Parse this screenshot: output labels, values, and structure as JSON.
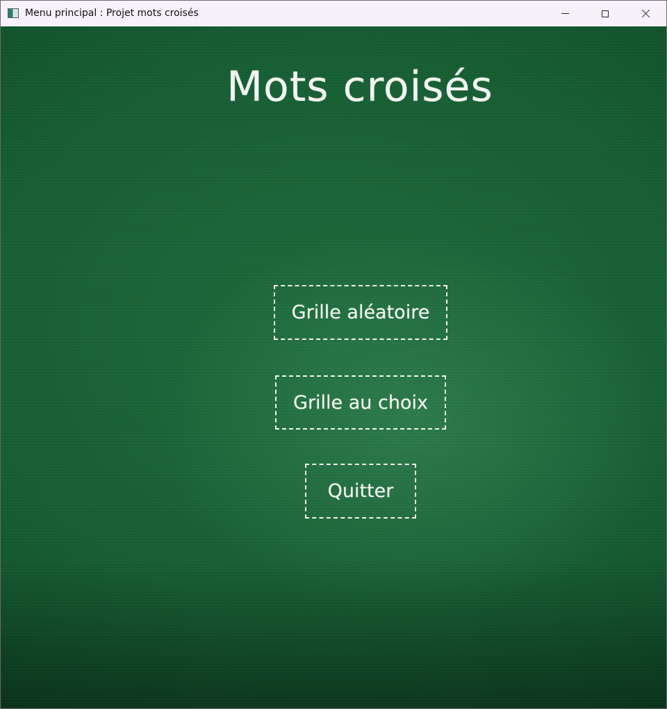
{
  "window": {
    "title": "Menu principal : Projet mots croisés",
    "controls": {
      "minimize_icon": "minimize-icon",
      "maximize_icon": "maximize-icon",
      "close_icon": "close-icon"
    }
  },
  "main": {
    "title": "Mots croisés",
    "buttons": {
      "random_grid": "Grille aléatoire",
      "chosen_grid": "Grille au choix",
      "quit": "Quitter"
    }
  },
  "colors": {
    "chalkboard": "#1d6a3c",
    "chalk": "#f2f5f0"
  }
}
